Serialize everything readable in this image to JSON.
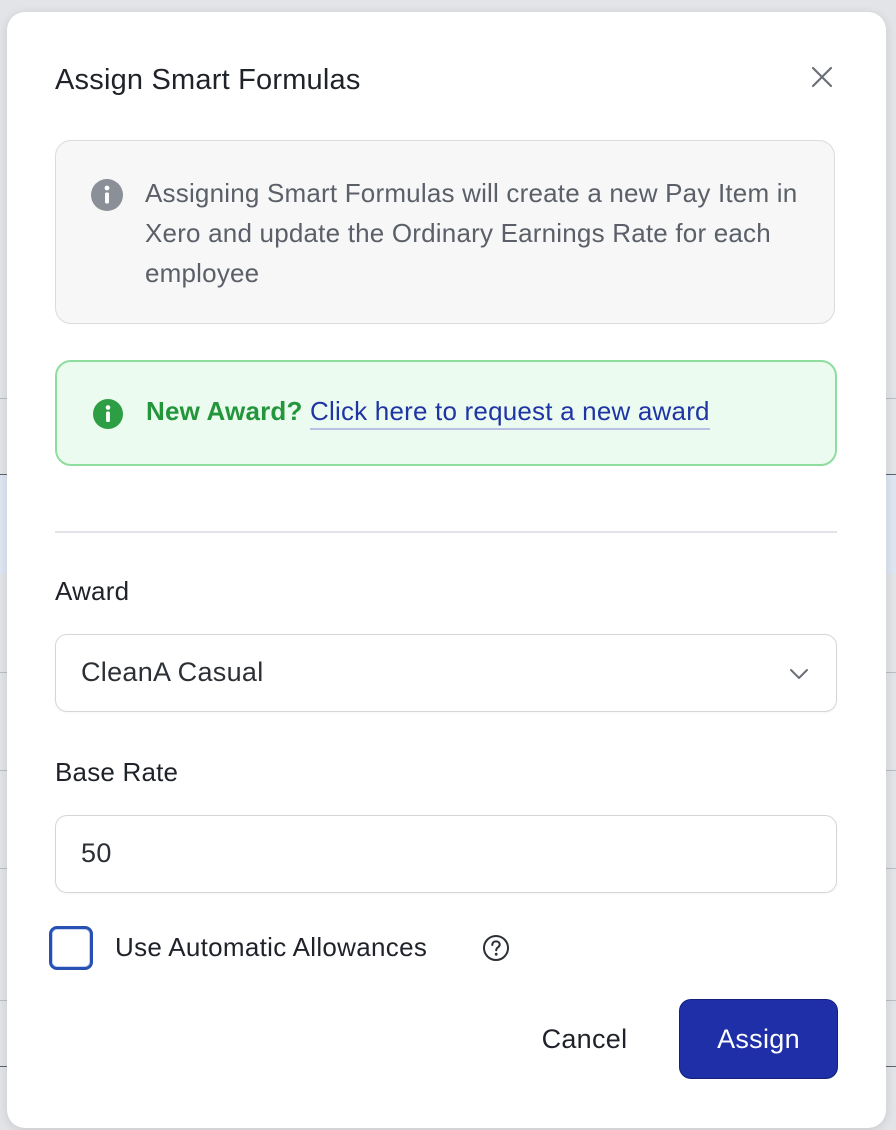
{
  "dialog": {
    "title": "Assign Smart Formulas",
    "close_icon": "close-icon"
  },
  "info_notice": {
    "icon": "info-circle-icon",
    "text": "Assigning Smart Formulas will create a new Pay Item in Xero and update the Ordinary Earnings Rate for each employee"
  },
  "award_notice": {
    "icon": "info-circle-icon",
    "question": "New Award?",
    "link_text": "Click here to request a new award",
    "accent_color": "#23963b"
  },
  "award_field": {
    "label": "Award",
    "selected_value": "CleanA Casual",
    "icon": "chevron-down-icon"
  },
  "base_rate_field": {
    "label": "Base Rate",
    "value": "50"
  },
  "automatic_allowances": {
    "label": "Use Automatic Allowances",
    "checked": false,
    "help_icon": "question-circle-icon"
  },
  "actions": {
    "cancel_label": "Cancel",
    "assign_label": "Assign",
    "primary_color": "#1e2fa8"
  }
}
